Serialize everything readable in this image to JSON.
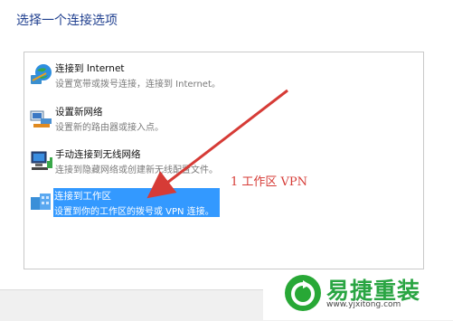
{
  "heading": "选择一个连接选项",
  "options": [
    {
      "title": "连接到 Internet",
      "desc": "设置宽带或拨号连接，连接到 Internet。",
      "icon": "globe-network-icon"
    },
    {
      "title": "设置新网络",
      "desc": "设置新的路由器或接入点。",
      "icon": "router-icon"
    },
    {
      "title": "手动连接到无线网络",
      "desc": "连接到隐藏网络或创建新无线配置文件。",
      "icon": "wireless-monitor-icon"
    },
    {
      "title": "连接到工作区",
      "desc": "设置到你的工作区的拨号或 VPN 连接。",
      "icon": "workplace-icon"
    }
  ],
  "annotation": "1 工作区  VPN",
  "watermark": {
    "brand": "易捷重装",
    "url": "www.yjxitong.com"
  },
  "colors": {
    "selection": "#3399ff",
    "heading": "#1f3f8f",
    "annotation": "#d63b36",
    "logo": "#28a836"
  }
}
